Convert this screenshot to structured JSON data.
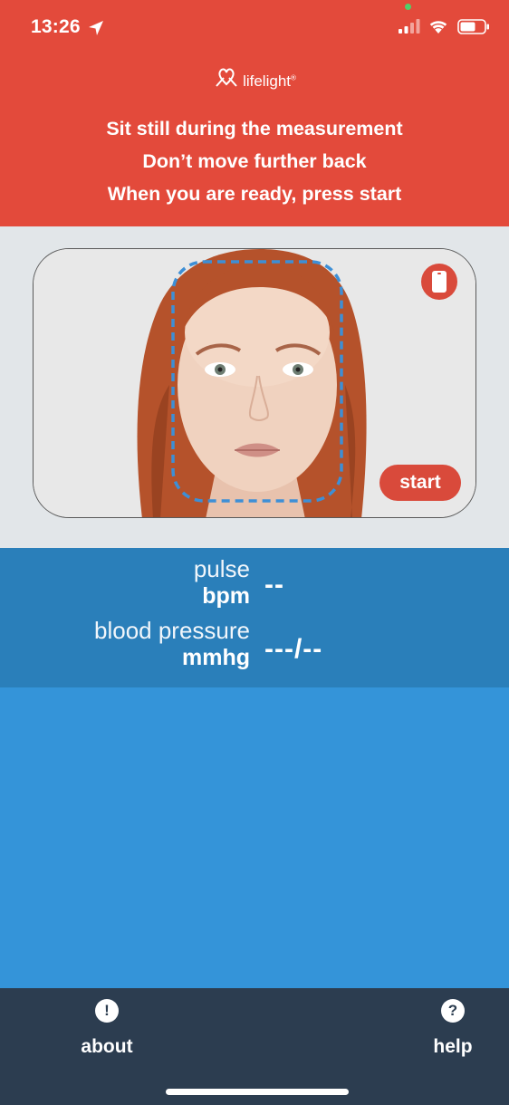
{
  "status_bar": {
    "time": "13:26"
  },
  "brand": {
    "name": "lifelight",
    "reg": "®"
  },
  "instructions": [
    "Sit still during the measurement",
    "Don’t move further back",
    "When you are ready, press start"
  ],
  "camera": {
    "start_label": "start"
  },
  "readings": {
    "pulse_label": "pulse",
    "pulse_unit": "bpm",
    "pulse_value": "--",
    "bp_label": "blood pressure",
    "bp_unit": "mmhg",
    "bp_value": "---/--"
  },
  "footer": {
    "about_label": "about",
    "about_icon": "!",
    "help_label": "help",
    "help_icon": "?"
  },
  "colors": {
    "header": "#e34a3b",
    "readings": "#2a7fba",
    "main": "#3494d9",
    "footer": "#2c3d50"
  }
}
